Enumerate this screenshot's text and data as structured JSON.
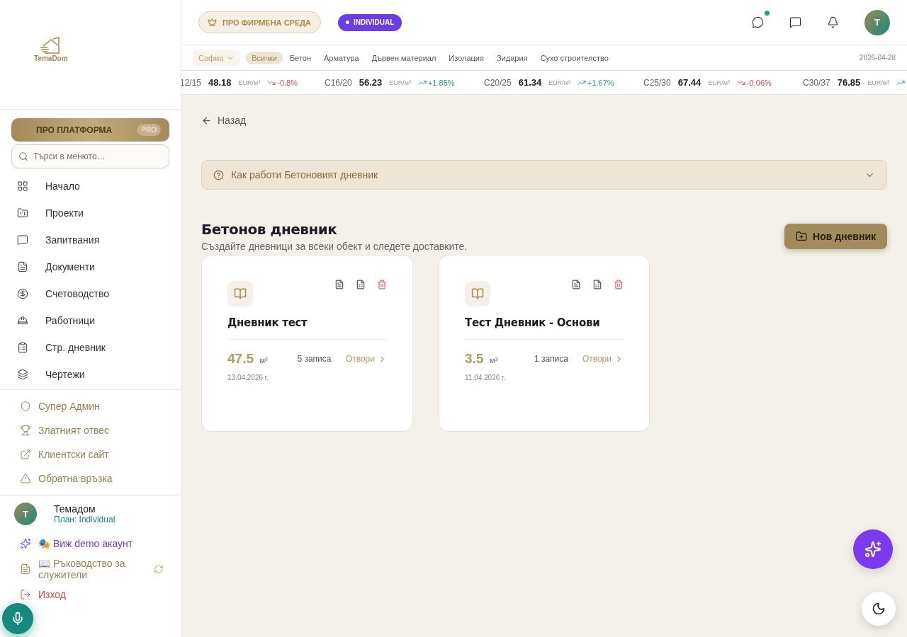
{
  "sidebar": {
    "logo": "TemaDom",
    "pro_button": {
      "label": "ПРО ПЛАТФОРМА",
      "badge": "PRO"
    },
    "search": {
      "placeholder": "Търси в менюто…"
    },
    "items": [
      {
        "label": "Начало"
      },
      {
        "label": "Проекти"
      },
      {
        "label": "Запитвания"
      },
      {
        "label": "Документи"
      },
      {
        "label": "Счетоводство"
      },
      {
        "label": "Работници"
      },
      {
        "label": "Стр. дневник"
      },
      {
        "label": "Чертежи"
      }
    ],
    "extra_links": [
      {
        "label": "Супер Админ"
      },
      {
        "label": "Златният отвес"
      },
      {
        "label": "Клиентски сайт"
      },
      {
        "label": "Обратна връзка"
      }
    ],
    "user": {
      "initial": "T",
      "name": "Темадом",
      "plan": "План: Individual"
    },
    "actions": [
      {
        "kind": "demo",
        "label": "🎭 Виж demo акаунт"
      },
      {
        "kind": "guide",
        "label": "📖 Ръководство за служители"
      },
      {
        "kind": "logout",
        "label": "Изход"
      }
    ]
  },
  "header": {
    "pro_badge": "ПРО ФИРМЕНА СРЕДА",
    "plan_badge": "INDIVIDUAL",
    "avatar": "T",
    "chat_unread": true
  },
  "market": {
    "city": "София",
    "categories": [
      {
        "label": "Всички",
        "selected": true
      },
      {
        "label": "Бетон",
        "selected": false
      },
      {
        "label": "Арматура",
        "selected": false
      },
      {
        "label": "Дървен материал",
        "selected": false
      },
      {
        "label": "Изолация",
        "selected": false
      },
      {
        "label": "Зидария",
        "selected": false
      },
      {
        "label": "Сухо строителство",
        "selected": false
      }
    ],
    "date": "2026-04-28",
    "ticker": [
      {
        "code": "12/15",
        "price": "48.18",
        "unit": "EUR/м³",
        "change": "-0.8%",
        "kind": "down"
      },
      {
        "code": "C16/20",
        "price": "56.23",
        "unit": "EUR/м³",
        "change": "+1.85%",
        "kind": "up"
      },
      {
        "code": "C20/25",
        "price": "61.34",
        "unit": "EUR/м³",
        "change": "+1.67%",
        "kind": "up"
      },
      {
        "code": "C25/30",
        "price": "67.44",
        "unit": "EUR/м³",
        "change": "-0.06%",
        "kind": "down"
      },
      {
        "code": "C30/37",
        "price": "76.85",
        "unit": "EUR/м³",
        "kind": "up"
      }
    ]
  },
  "back": "Назад",
  "help": {
    "label": "Как работи Бетоновият дневник",
    "expanded": false
  },
  "page": {
    "title": "Бетонов дневник",
    "subtitle": "Създайте дневници за всеки обект и следете доставките.",
    "new_button": "Нов дневник"
  },
  "journals": [
    {
      "name": "Дневник тест",
      "volume": "47.5",
      "unit": "м³",
      "entries": "5 записа",
      "open": "Отвори",
      "date": "13.04.2026 г."
    },
    {
      "name": "Тест Дневник - Основи",
      "volume": "3.5",
      "unit": "м³",
      "entries": "1 записа",
      "open": "Отвори",
      "date": "11.04.2026 г."
    }
  ]
}
